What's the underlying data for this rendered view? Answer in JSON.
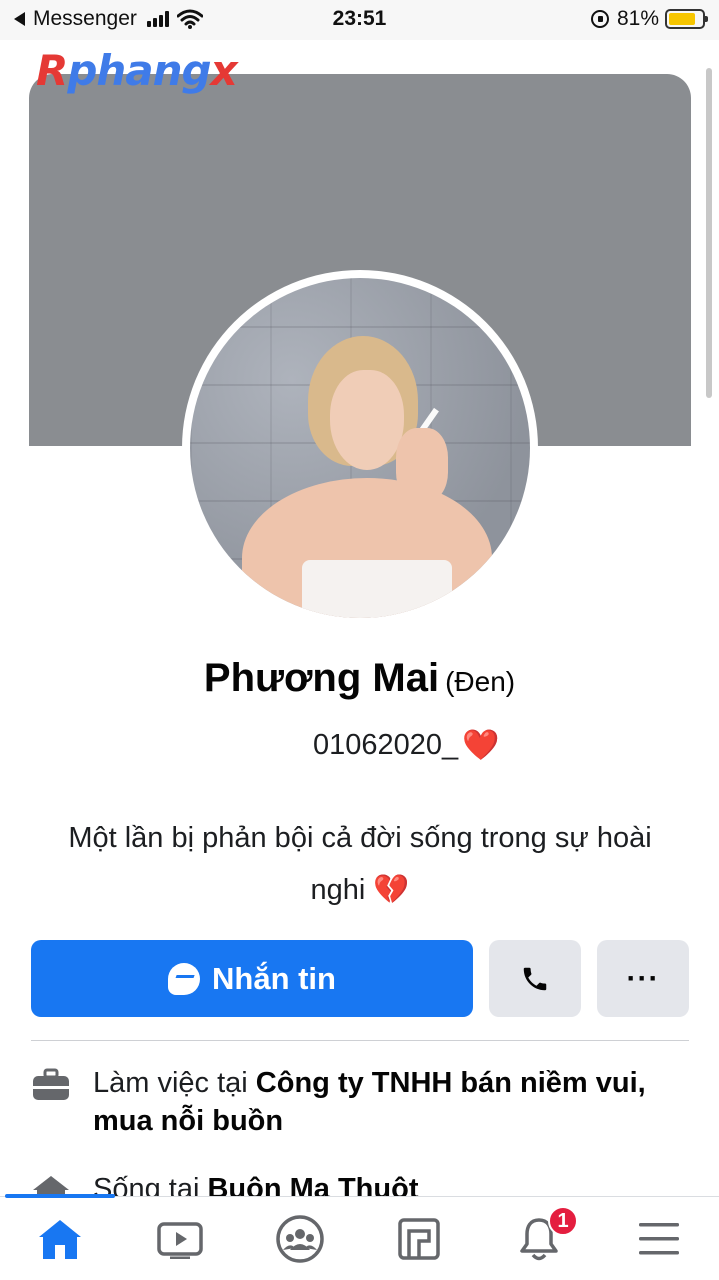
{
  "status_bar": {
    "back_app": "Messenger",
    "time": "23:51",
    "battery": "81%",
    "battery_level": 0.81
  },
  "watermark": {
    "part1": "R",
    "part2": "phang",
    "part3": "x"
  },
  "profile": {
    "name": "Phương Mai",
    "alternate_name": "(Đen)",
    "tagline": "01062020_",
    "tagline_emoji": "❤️",
    "bio_text": "Một lần bị phản bội cả đời sống trong sự hoài nghi",
    "bio_emoji": "💔"
  },
  "actions": {
    "message_label": "Nhắn tin",
    "more_label": "···"
  },
  "intro": {
    "work_prefix": "Làm việc tại ",
    "work_place": "Công ty TNHH bán niềm vui, mua nỗi buồn",
    "lives_prefix": "Sống tại ",
    "lives_place": "Buôn Ma Thuột"
  },
  "tab_bar": {
    "items": [
      "home-icon",
      "watch-icon",
      "groups-icon",
      "pages-icon",
      "notifications-icon",
      "menu-icon"
    ],
    "notification_count": "1",
    "accent_color": "#1877f2"
  },
  "colors": {
    "primary": "#1877f2",
    "cover": "#8a8d91",
    "button_secondary": "#e4e6eb",
    "badge": "#e41e3f"
  }
}
